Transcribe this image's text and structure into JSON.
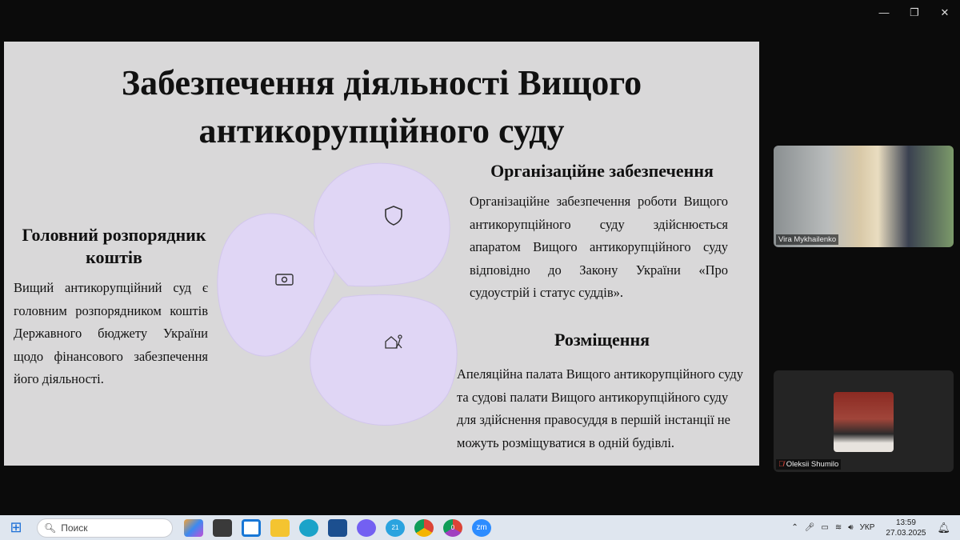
{
  "window": {
    "minimize": "—",
    "restore": "❐",
    "close": "✕"
  },
  "slide": {
    "title_line1": "Забезпечення діяльності Вищого",
    "title_line2": "антикорупційного суду",
    "left": {
      "heading_line1": "Головний розпорядник",
      "heading_line2": "коштів",
      "text": "Вищий антикорупційний суд є головним розпорядником коштів Державного бюджету України щодо фінансового забезпечення",
      "text_last": "його діяльності."
    },
    "right_top": {
      "heading": "Організаційне забезпечення",
      "text": "Організаційне забезпечення роботи Вищого антикорупційного суду здійснюється апаратом Вищого антикорупційного суду відповідно до Закону України «Про",
      "text_last": "судоустрій і статус суддів»."
    },
    "right_bottom": {
      "heading": "Розміщення",
      "lines": [
        "Апеляційна палата Вищого антикорупційного суду",
        "та судові палати Вищого антикорупційного суду",
        "для здійснення  правосуддя в першій інстанції не",
        "можуть розміщуватися в одній будівлі."
      ]
    },
    "blob_color": "#e0d6f5"
  },
  "participants": [
    {
      "name": "Vira Mykhailenko"
    },
    {
      "name": "Oleksii Shumilo"
    }
  ],
  "taskbar": {
    "search_placeholder": "Поиск",
    "badges": {
      "telegram": "21",
      "chrome2": "0"
    },
    "zoom_label": "zm",
    "tray": {
      "language": "УКР",
      "time": "13:59",
      "date": "27.03.2025"
    }
  }
}
